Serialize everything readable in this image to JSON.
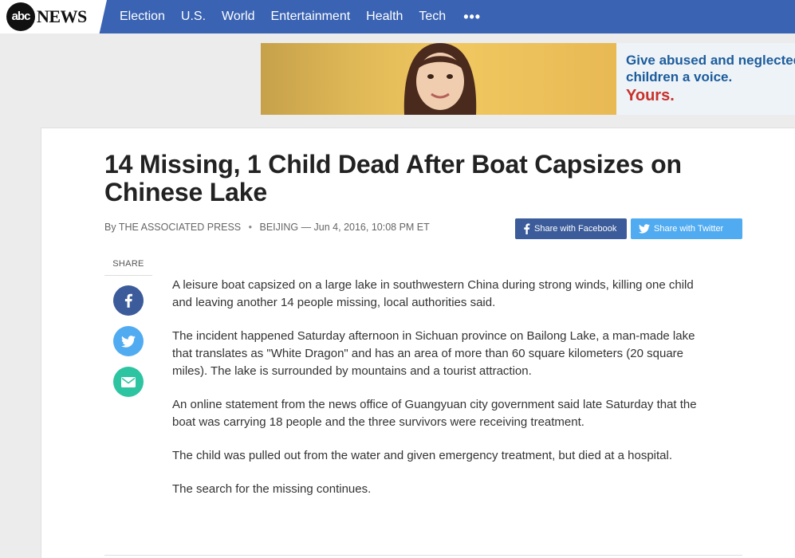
{
  "header": {
    "logo_abc": "abc",
    "logo_news": "NEWS",
    "nav": [
      "Election",
      "U.S.",
      "World",
      "Entertainment",
      "Health",
      "Tech"
    ],
    "more": "•••",
    "colors": {
      "nav_bg": "#3a63b3"
    }
  },
  "ad": {
    "line1": "Give abused and neglected",
    "line2": "children a voice.",
    "line3": "Yours."
  },
  "article": {
    "headline": "14 Missing, 1 Child Dead After Boat Capsizes on Chinese Lake",
    "by": "By",
    "author": "THE ASSOCIATED PRESS",
    "dateline": "BEIJING — Jun 4, 2016, 10:08 PM ET",
    "share_facebook": "Share with Facebook",
    "share_twitter": "Share with Twitter",
    "share_label": "SHARE",
    "paragraphs": [
      "A leisure boat capsized on a large lake in southwestern China during strong winds, killing one child and leaving another 14 people missing, local authorities said.",
      "The incident happened Saturday afternoon in Sichuan province on Bailong Lake, a man-made lake that translates as \"White Dragon\" and has an area of more than 60 square kilometers (20 square miles). The lake is surrounded by mountains and a tourist attraction.",
      "An online statement from the news office of Guangyuan city government said late Saturday that the boat was carrying 18 people and the three survivors were receiving treatment.",
      "The child was pulled out from the water and given emergency treatment, but died at a hospital.",
      "The search for the missing continues."
    ]
  }
}
